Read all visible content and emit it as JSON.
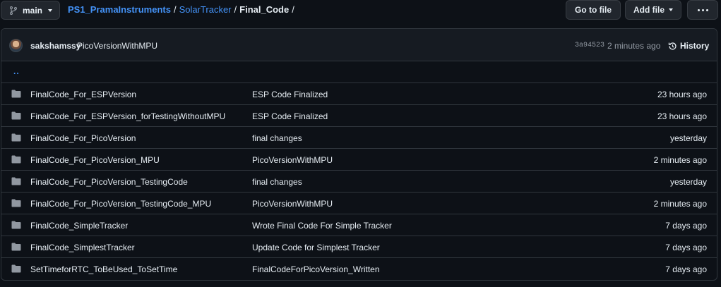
{
  "toolbar": {
    "branch": "main",
    "goto_file": "Go to file",
    "add_file": "Add file"
  },
  "breadcrumb": {
    "repo": "PS1_PramaInstruments",
    "dir": "SolarTracker",
    "current": "Final_Code"
  },
  "commit": {
    "author": "sakshamssy",
    "message": "PicoVersionWithMPU",
    "sha": "3a94523",
    "time": "2 minutes ago",
    "history": "History"
  },
  "parent_link": "..",
  "files": [
    {
      "name": "FinalCode_For_ESPVersion",
      "message": "ESP Code Finalized",
      "age": "23 hours ago"
    },
    {
      "name": "FinalCode_For_ESPVersion_forTestingWithoutMPU",
      "message": "ESP Code Finalized",
      "age": "23 hours ago"
    },
    {
      "name": "FinalCode_For_PicoVersion",
      "message": "final changes",
      "age": "yesterday"
    },
    {
      "name": "FinalCode_For_PicoVersion_MPU",
      "message": "PicoVersionWithMPU",
      "age": "2 minutes ago"
    },
    {
      "name": "FinalCode_For_PicoVersion_TestingCode",
      "message": "final changes",
      "age": "yesterday"
    },
    {
      "name": "FinalCode_For_PicoVersion_TestingCode_MPU",
      "message": "PicoVersionWithMPU",
      "age": "2 minutes ago"
    },
    {
      "name": "FinalCode_SimpleTracker",
      "message": "Wrote Final Code For Simple Tracker",
      "age": "7 days ago"
    },
    {
      "name": "FinalCode_SimplestTracker",
      "message": "Update Code for Simplest Tracker",
      "age": "7 days ago"
    },
    {
      "name": "SetTimeforRTC_ToBeUsed_ToSetTime",
      "message": "FinalCodeForPicoVersion_Written",
      "age": "7 days ago"
    }
  ]
}
